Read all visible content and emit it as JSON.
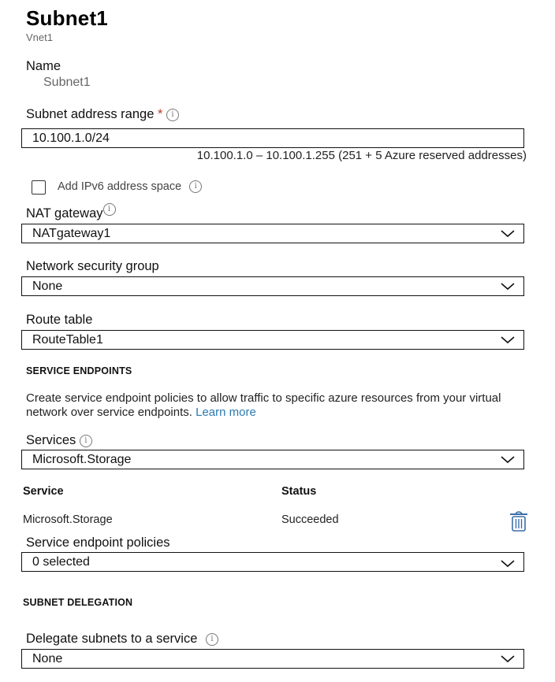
{
  "header": {
    "title": "Subnet1",
    "subtitle": "Vnet1"
  },
  "name_field": {
    "label": "Name",
    "value": "Subnet1"
  },
  "address_range": {
    "label": "Subnet address range",
    "required_mark": "*",
    "info_glyph": "i",
    "value": "10.100.1.0/24",
    "hint": "10.100.1.0 – 10.100.1.255 (251 + 5 Azure reserved addresses)"
  },
  "ipv6": {
    "label": "Add IPv6 address space",
    "checked": false,
    "info_glyph": "i"
  },
  "nat_gateway": {
    "label": "NAT gateway",
    "info_glyph": "i",
    "value": "NATgateway1"
  },
  "nsg": {
    "label": "Network security group",
    "value": "None"
  },
  "route_table": {
    "label": "Route table",
    "value": "RouteTable1"
  },
  "service_endpoints": {
    "heading": "SERVICE ENDPOINTS",
    "description": "Create service endpoint policies to allow traffic to specific azure resources from your virtual network over service endpoints.",
    "learn_more": "Learn more",
    "link_color": "#2a7ab0",
    "services": {
      "label": "Services",
      "info_glyph": "i",
      "value": "Microsoft.Storage"
    },
    "table": {
      "columns": [
        "Service",
        "Status"
      ],
      "rows": [
        {
          "service": "Microsoft.Storage",
          "status": "Succeeded",
          "action_icon": "trash-icon"
        }
      ]
    },
    "policies": {
      "label": "Service endpoint policies",
      "value": "0 selected"
    }
  },
  "delegation": {
    "heading": "SUBNET DELEGATION",
    "field": {
      "label": "Delegate subnets to a service",
      "info_glyph": "i",
      "value": "None"
    }
  },
  "colors": {
    "trash_icon": "#3b6fa8",
    "required": "#c0392b"
  }
}
